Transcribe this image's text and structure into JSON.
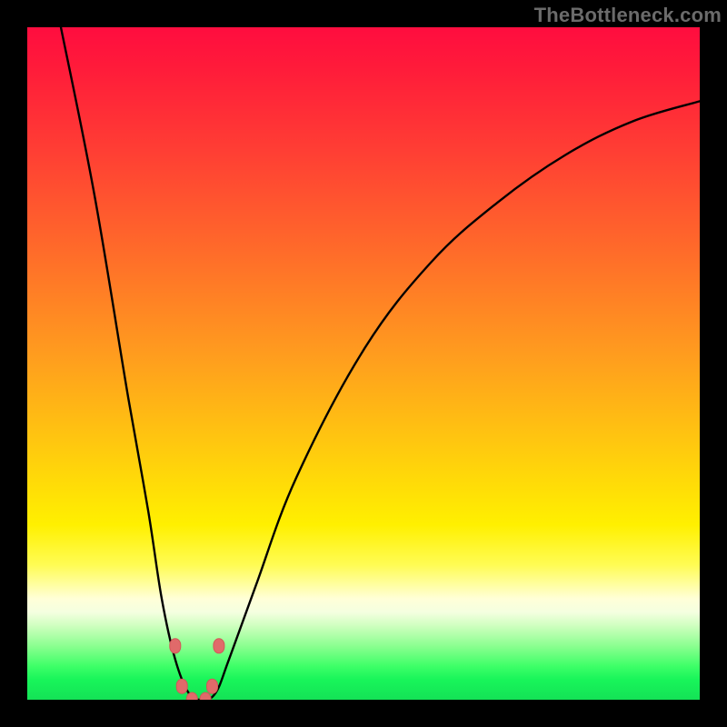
{
  "watermark": {
    "text": "TheBottleneck.com"
  },
  "colors": {
    "background": "#000000",
    "curve_stroke": "#000000",
    "marker_fill": "#e06a6a",
    "marker_stroke": "#d25858"
  },
  "chart_data": {
    "type": "line",
    "title": "",
    "xlabel": "",
    "ylabel": "",
    "xlim": [
      0,
      100
    ],
    "ylim": [
      0,
      100
    ],
    "grid": false,
    "legend": false,
    "note": "No axis ticks or numeric labels are shown in the image; values below are geometric estimates from the plotted curve, scaled to 0–100 on each axis.",
    "series": [
      {
        "name": "curve",
        "x": [
          5,
          10,
          15,
          18,
          20,
          22,
          24,
          26,
          28,
          30,
          34,
          40,
          50,
          60,
          70,
          80,
          90,
          100
        ],
        "values": [
          100,
          75,
          45,
          28,
          15,
          6,
          1,
          0,
          1,
          6,
          17,
          33,
          52,
          65,
          74,
          81,
          86,
          89
        ]
      }
    ],
    "markers": [
      {
        "x": 22.0,
        "y": 8
      },
      {
        "x": 28.5,
        "y": 8
      },
      {
        "x": 23.0,
        "y": 2
      },
      {
        "x": 27.5,
        "y": 2
      },
      {
        "x": 24.5,
        "y": 0
      },
      {
        "x": 26.5,
        "y": 0
      }
    ]
  }
}
